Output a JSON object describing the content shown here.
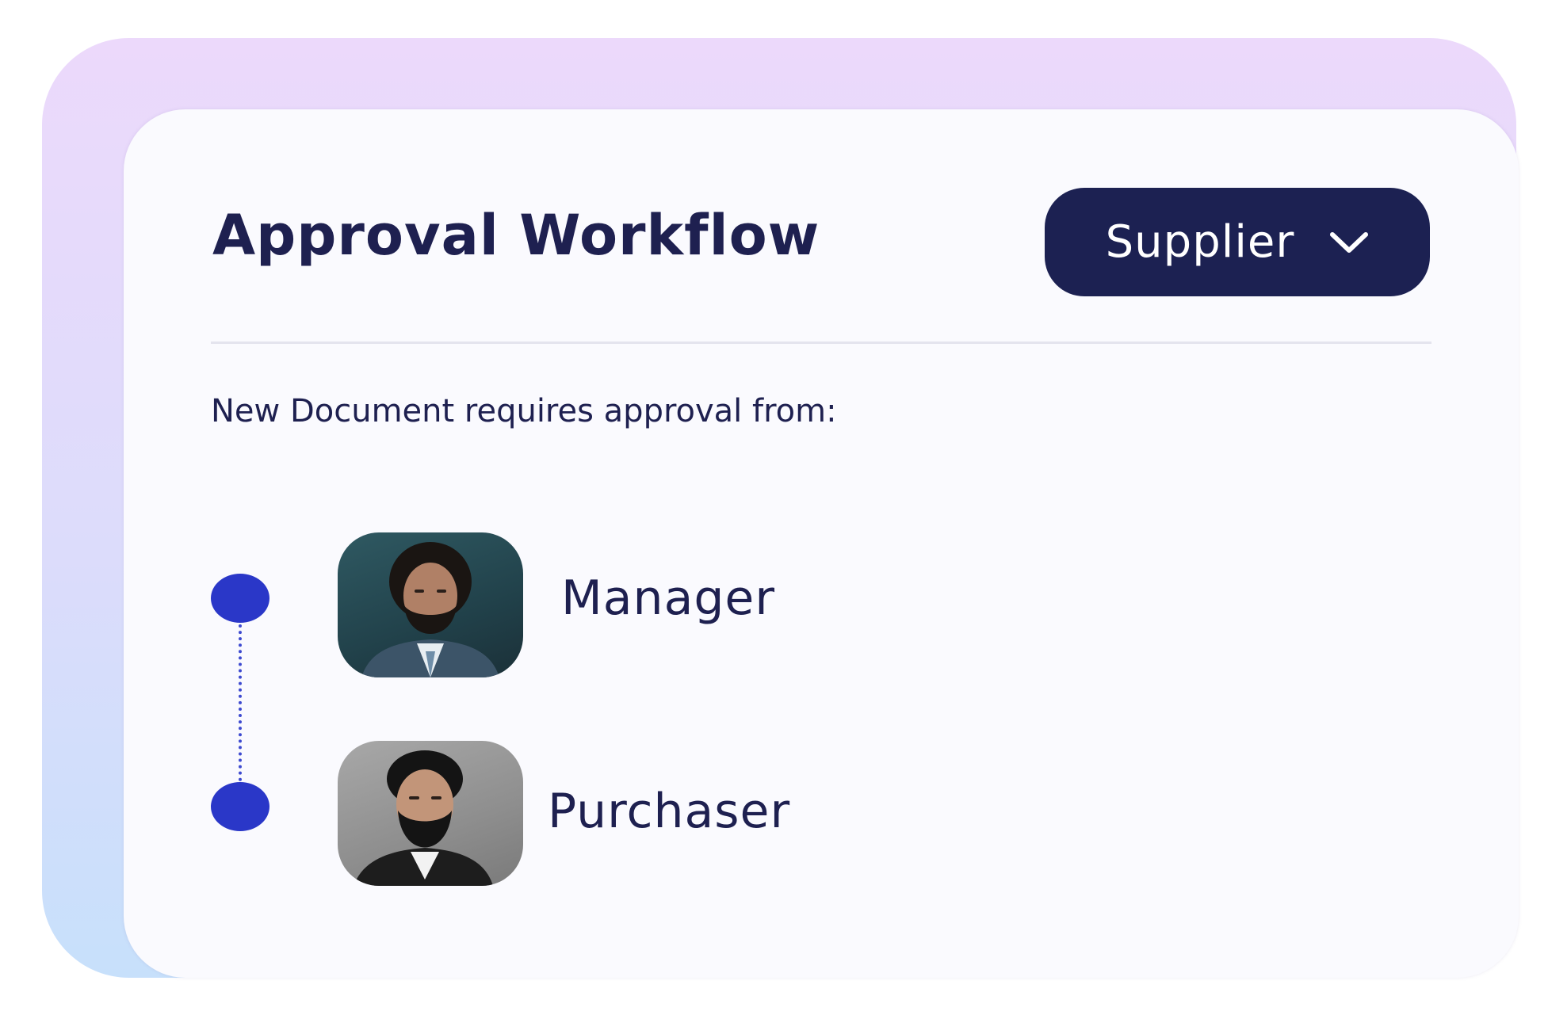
{
  "header": {
    "title": "Approval Workflow",
    "role_selector": {
      "selected": "Supplier",
      "icon": "chevron-down-icon"
    }
  },
  "subtitle": "New Document requires approval from:",
  "approvers": [
    {
      "role": "Manager",
      "avatar": "manager-avatar"
    },
    {
      "role": "Purchaser",
      "avatar": "purchaser-avatar"
    }
  ],
  "colors": {
    "accent": "#1c2152",
    "timeline": "#2a37c8",
    "text": "#1e2050",
    "frame_top": "#ecd9fb",
    "frame_bottom": "#c7e0fb"
  }
}
